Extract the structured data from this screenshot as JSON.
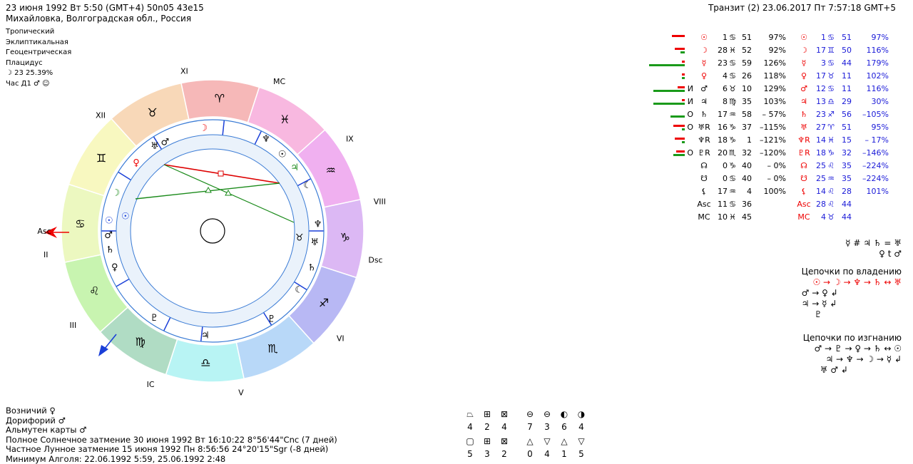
{
  "header": {
    "left_line1": "23 июня 1992  Вт   5:50 (GMT+4) 50n05  43e15",
    "left_line2": "Михайловка, Волгоградская обл., Россия",
    "right": "Транзит (2) 23.06.2017  Пт  7:57:18 GMT+5"
  },
  "settings": {
    "lines": [
      "Тропический",
      "Эклиптикальная",
      "Геоцентрическая",
      "Плацидус"
    ],
    "moon_phase": "☽  23 25.39%",
    "hour": "Час Д1  ♂ ☺"
  },
  "wheel": {
    "house_labels": [
      "XI",
      "MC",
      "IX",
      "VIII",
      "Dsc",
      "VI",
      "V",
      "IC",
      "III",
      "II",
      "Asc",
      "XII"
    ],
    "signs": [
      "♈",
      "♓",
      "♒",
      "♑",
      "♐",
      "♏",
      "♎",
      "♍",
      "♌",
      "♋",
      "♊",
      "♉"
    ],
    "sign_colors": [
      "#f6b8b8",
      "#f8b8e0",
      "#f0b0f0",
      "#dcb8f4",
      "#b8b8f4",
      "#b8d8f8",
      "#b8f4f4",
      "#b0dcc4",
      "#c8f4b0",
      "#ecf8c0",
      "#f8f8c0",
      "#f8d8b8"
    ]
  },
  "positions": {
    "rows": [
      {
        "icon_l": "",
        "g1": "☉",
        "n1": "1",
        "s1": "♋",
        "m1": "51",
        "p1": "97%",
        "g2": "☉",
        "n2": "1",
        "s2": "♋",
        "m2": "51",
        "p2": "97%"
      },
      {
        "icon_l": "",
        "g1": "☽",
        "n1": "28",
        "s1": "♓",
        "m1": "52",
        "p1": "92%",
        "g2": "☽",
        "n2": "17",
        "s2": "♊",
        "m2": "50",
        "p2": "116%"
      },
      {
        "icon_l": "",
        "g1": "☿",
        "n1": "23",
        "s1": "♋",
        "m1": "59",
        "p1": "126%",
        "g2": "☿",
        "n2": "3",
        "s2": "♋",
        "m2": "44",
        "p2": "179%"
      },
      {
        "icon_l": "",
        "g1": "♀",
        "n1": "4",
        "s1": "♋",
        "m1": "26",
        "p1": "118%",
        "g2": "♀",
        "n2": "17",
        "s2": "♉",
        "m2": "11",
        "p2": "102%"
      },
      {
        "icon_l": "И",
        "g1": "♂",
        "n1": "6",
        "s1": "♉",
        "m1": "10",
        "p1": "129%",
        "g2": "♂",
        "n2": "12",
        "s2": "♋",
        "m2": "11",
        "p2": "116%"
      },
      {
        "icon_l": "И",
        "g1": "♃",
        "n1": "8",
        "s1": "♍",
        "m1": "35",
        "p1": "103%",
        "g2": "♃",
        "n2": "13",
        "s2": "♎",
        "m2": "29",
        "p2": "30%"
      },
      {
        "icon_l": "О",
        "g1": "♄",
        "n1": "17",
        "s1": "♒",
        "m1": "58",
        "p1": "– 57%",
        "g2": "♄",
        "n2": "23",
        "s2": "♐",
        "m2": "56",
        "p2": "–105%"
      },
      {
        "icon_l": "О",
        "g1": "♅R",
        "n1": "16",
        "s1": "♑",
        "m1": "37",
        "p1": "–115%",
        "g2": "♅",
        "n2": "27",
        "s2": "♈",
        "m2": "51",
        "p2": "95%"
      },
      {
        "icon_l": "",
        "g1": "♆R",
        "n1": "18",
        "s1": "♑",
        "m1": "1",
        "p1": "–121%",
        "g2": "♆R",
        "n2": "14",
        "s2": "♓",
        "m2": "15",
        "p2": "– 17%"
      },
      {
        "icon_l": "О",
        "g1": "♇R",
        "n1": "20",
        "s1": "♏",
        "m1": "32",
        "p1": "–120%",
        "g2": "♇R",
        "n2": "18",
        "s2": "♑",
        "m2": "32",
        "p2": "–146%"
      },
      {
        "icon_l": "",
        "g1": "☊",
        "n1": "0",
        "s1": "♑",
        "m1": "40",
        "p1": "– 0%",
        "g2": "☊",
        "n2": "25",
        "s2": "♌",
        "m2": "35",
        "p2": "–224%"
      },
      {
        "icon_l": "",
        "g1": "☋",
        "n1": "0",
        "s1": "♋",
        "m1": "40",
        "p1": "– 0%",
        "g2": "☋",
        "n2": "25",
        "s2": "♒",
        "m2": "35",
        "p2": "–224%"
      },
      {
        "icon_l": "",
        "g1": "⚸",
        "n1": "17",
        "s1": "♒",
        "m1": "4",
        "p1": "100%",
        "g2": "⚸",
        "n2": "14",
        "s2": "♌",
        "m2": "28",
        "p2": "101%"
      },
      {
        "icon_l": "",
        "g1": "Asc",
        "n1": "11",
        "s1": "♋",
        "m1": "36",
        "p1": "",
        "g2": "Asc",
        "n2": "28",
        "s2": "♌",
        "m2": "44",
        "p2": ""
      },
      {
        "icon_l": "",
        "g1": "MC",
        "n1": "10",
        "s1": "♓",
        "m1": "45",
        "p1": "",
        "g2": "MC",
        "n2": "4",
        "s2": "♉",
        "m2": "44",
        "p2": ""
      }
    ],
    "bars": [
      {
        "red": 18,
        "green": 0
      },
      {
        "red": 14,
        "green": 6
      },
      {
        "red": 4,
        "green": 50
      },
      {
        "red": 4,
        "green": 4
      },
      {
        "red": 10,
        "green": 44
      },
      {
        "red": 4,
        "green": 44
      },
      {
        "red": 0,
        "green": 20
      },
      {
        "red": 16,
        "green": 4
      },
      {
        "red": 14,
        "green": 4
      },
      {
        "red": 12,
        "green": 16
      }
    ]
  },
  "relations": {
    "line1": "☿ # ♃ ♄ = ♅",
    "line2": "♀ t ♂"
  },
  "chains_rule": {
    "title": "Цепочки по владению",
    "line1": "☉ → ☽ → ♆ → ♄ ↔ ♅",
    "line2": "♂ → ♀ ↲",
    "line3": "♃ → ☿ ↲",
    "line4": "♇"
  },
  "chains_exile": {
    "title": "Цепочки по изгнанию",
    "line1": "♂ → ♇ → ♀ → ♄ ↔ ☉",
    "line2": "♃ → ♆ → ☽ → ☿ ↲",
    "line3": "♅ ♂ ↲"
  },
  "footer": {
    "line1": "Возничий  ♀",
    "line2": "Дорифорий  ♂",
    "line3": "Альмутен карты  ♂",
    "line4": "Полное Солнечное затмение 30 июня 1992 Вт 16:10:22  8°56'44\"Cnc (7 дней)",
    "line5": "Частное Лунное затмение 15 июня 1992 Пн  8:56:56 24°20'15\"Sgr (-8 дней)",
    "line6": "Минимум Алголя: 22.06.1992  5:59,  25.06.1992  2:48"
  },
  "quadrants": {
    "icons_top": [
      "⏢",
      "⊞",
      "⊠",
      "⊖",
      "⊖",
      "◐",
      "◑"
    ],
    "vals_top": [
      "4",
      "2",
      "4",
      "7",
      "3",
      "6",
      "4"
    ],
    "icons_bottom": [
      "▢",
      "⊞",
      "⊠",
      "△",
      "▽",
      "△",
      "▽"
    ],
    "vals_bottom": [
      "5",
      "3",
      "2",
      "0",
      "4",
      "1",
      "5"
    ]
  }
}
